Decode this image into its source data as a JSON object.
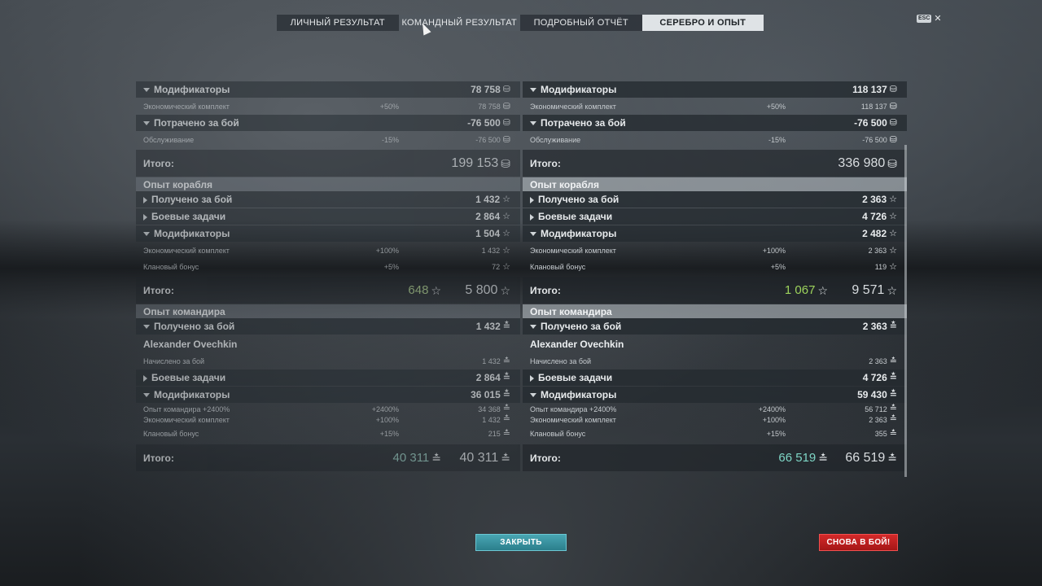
{
  "tabs": [
    {
      "label": "ЛИЧНЫЙ РЕЗУЛЬТАТ"
    },
    {
      "label": "КОМАНДНЫЙ РЕЗУЛЬТАТ"
    },
    {
      "label": "ПОДРОБНЫЙ ОТЧЁТ"
    },
    {
      "label": "СЕРЕБРО И ОПЫТ"
    }
  ],
  "active_tab": "СЕРЕБРО И ОПЫТ",
  "esc": {
    "key": "ESC",
    "close": "✕"
  },
  "icons": {
    "credits": "credits-icon",
    "xp": "star-icon",
    "commander_xp": "commander-xp-icon"
  },
  "colors": {
    "free_xp": "#9dd35c",
    "commander_total": "#7ed6c6",
    "close_button": "#2b7f8c",
    "battle_button": "#c41f1f"
  },
  "left": {
    "credits": {
      "modifiers": {
        "label": "Модификаторы",
        "value": "78 758"
      },
      "economic": {
        "label": "Экономический комплект",
        "pct": "+50%",
        "value": "78 758"
      },
      "spent": {
        "label": "Потрачено за бой",
        "value": "-76 500"
      },
      "service": {
        "label": "Обслуживание",
        "pct": "-15%",
        "value": "-76 500"
      },
      "total": {
        "label": "Итого:",
        "value": "199 153"
      }
    },
    "ship": {
      "title": "Опыт корабля",
      "earned": {
        "label": "Получено за бой",
        "value": "1 432"
      },
      "tasks": {
        "label": "Боевые задачи",
        "value": "2 864"
      },
      "modifiers": {
        "label": "Модификаторы",
        "value": "1 504"
      },
      "economic": {
        "label": "Экономический комплект",
        "pct": "+100%",
        "value": "1 432"
      },
      "clan": {
        "label": "Клановый бонус",
        "pct": "+5%",
        "value": "72"
      },
      "total": {
        "label": "Итого:",
        "free": "648",
        "value": "5 800"
      }
    },
    "commander": {
      "title": "Опыт командира",
      "earned": {
        "label": "Получено за бой",
        "value": "1 432"
      },
      "name": "Alexander Ovechkin",
      "accrued": {
        "label": "Начислено за бой",
        "value": "1 432"
      },
      "tasks": {
        "label": "Боевые задачи",
        "value": "2 864"
      },
      "modifiers": {
        "label": "Модификаторы",
        "value": "36 015"
      },
      "cmd_xp": {
        "label": "Опыт командира +2400%",
        "pct": "+2400%",
        "value": "34 368"
      },
      "economic": {
        "label": "Экономический комплект",
        "pct": "+100%",
        "value": "1 432"
      },
      "clan": {
        "label": "Клановый бонус",
        "pct": "+15%",
        "value": "215"
      },
      "total": {
        "label": "Итого:",
        "elite": "40 311",
        "value": "40 311"
      }
    }
  },
  "right": {
    "credits": {
      "modifiers": {
        "label": "Модификаторы",
        "value": "118 137"
      },
      "economic": {
        "label": "Экономический комплект",
        "pct": "+50%",
        "value": "118 137"
      },
      "spent": {
        "label": "Потрачено за бой",
        "value": "-76 500"
      },
      "service": {
        "label": "Обслуживание",
        "pct": "-15%",
        "value": "-76 500"
      },
      "total": {
        "label": "Итого:",
        "value": "336 980"
      }
    },
    "ship": {
      "title": "Опыт корабля",
      "earned": {
        "label": "Получено за бой",
        "value": "2 363"
      },
      "tasks": {
        "label": "Боевые задачи",
        "value": "4 726"
      },
      "modifiers": {
        "label": "Модификаторы",
        "value": "2 482"
      },
      "economic": {
        "label": "Экономический комплект",
        "pct": "+100%",
        "value": "2 363"
      },
      "clan": {
        "label": "Клановый бонус",
        "pct": "+5%",
        "value": "119"
      },
      "total": {
        "label": "Итого:",
        "free": "1 067",
        "value": "9 571"
      }
    },
    "commander": {
      "title": "Опыт командира",
      "earned": {
        "label": "Получено за бой",
        "value": "2 363"
      },
      "name": "Alexander Ovechkin",
      "accrued": {
        "label": "Начислено за бой",
        "value": "2 363"
      },
      "tasks": {
        "label": "Боевые задачи",
        "value": "4 726"
      },
      "modifiers": {
        "label": "Модификаторы",
        "value": "59 430"
      },
      "cmd_xp": {
        "label": "Опыт командира +2400%",
        "pct": "+2400%",
        "value": "56 712"
      },
      "economic": {
        "label": "Экономический комплект",
        "pct": "+100%",
        "value": "2 363"
      },
      "clan": {
        "label": "Клановый бонус",
        "pct": "+15%",
        "value": "355"
      },
      "total": {
        "label": "Итого:",
        "elite": "66 519",
        "value": "66 519"
      }
    }
  },
  "buttons": {
    "close": "ЗАКРЫТЬ",
    "battle": "СНОВА В БОЙ!"
  }
}
